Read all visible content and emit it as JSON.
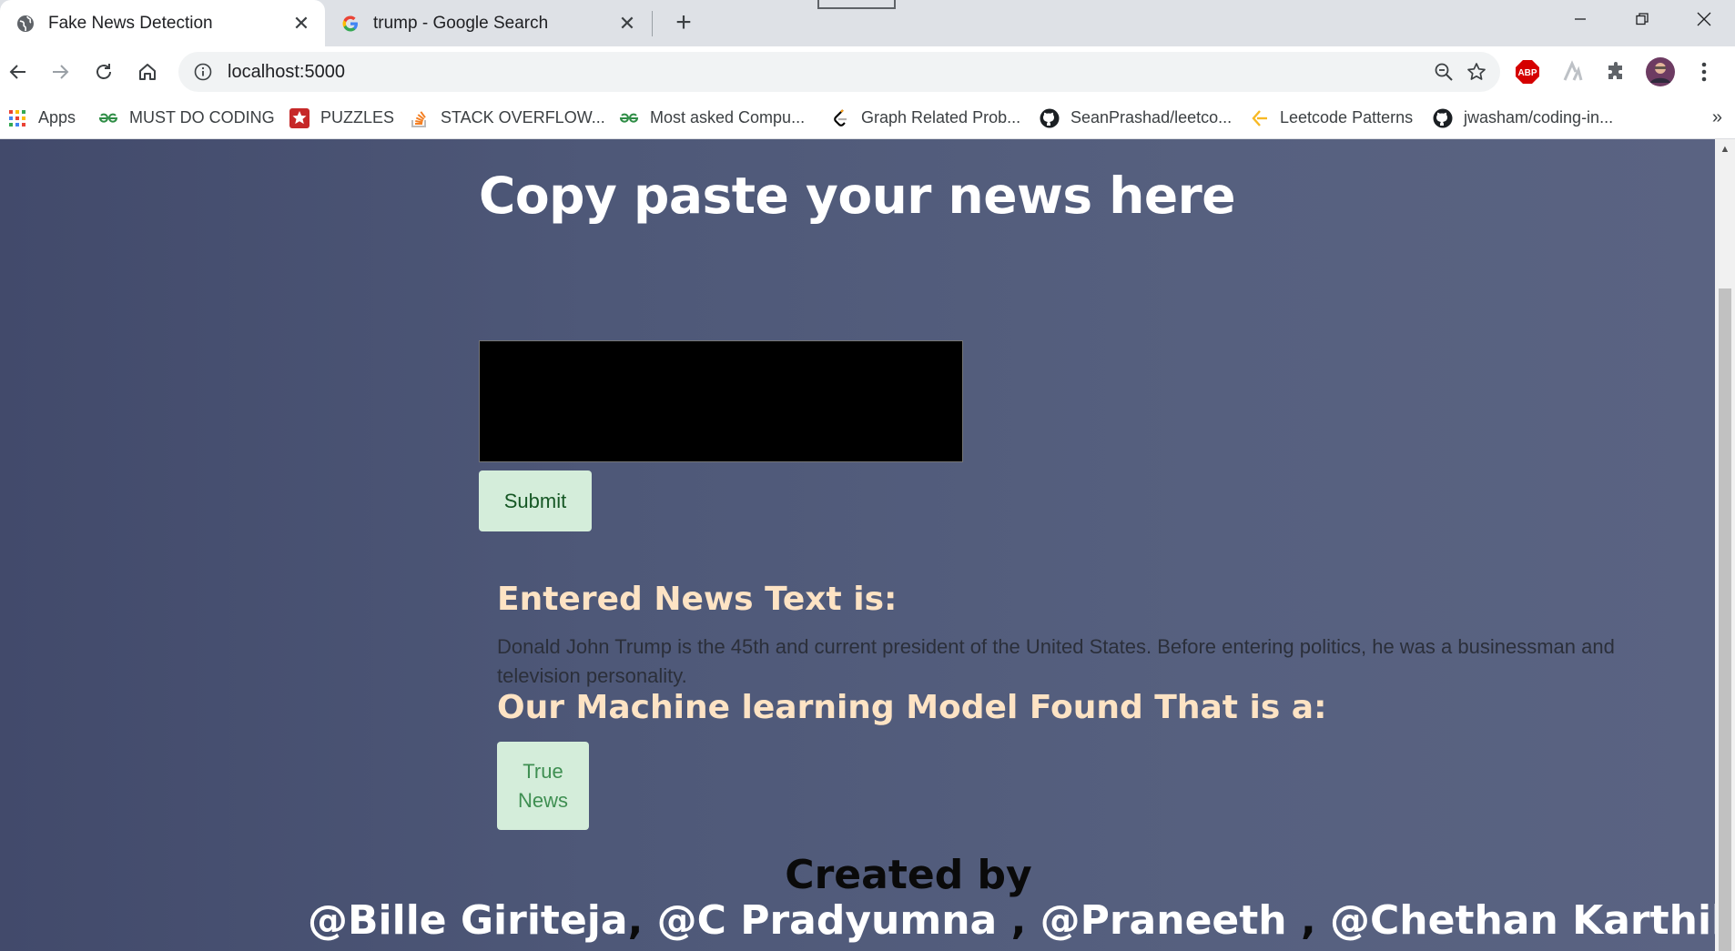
{
  "browser": {
    "tabs": [
      {
        "title": "Fake News Detection",
        "icon": "globe-icon",
        "active": true
      },
      {
        "title": "trump - Google Search",
        "icon": "google-icon",
        "active": false
      }
    ],
    "url": "localhost:5000",
    "bookmarks": [
      {
        "label": "Apps",
        "icon": "apps-grid-icon"
      },
      {
        "label": "MUST DO CODING",
        "icon": "gfg-icon"
      },
      {
        "label": "PUZZLES",
        "icon": "puzzle-star-icon"
      },
      {
        "label": "STACK OVERFLOW...",
        "icon": "stackoverflow-icon"
      },
      {
        "label": "Most asked Compu...",
        "icon": "gfg-icon"
      },
      {
        "label": "Graph Related Prob...",
        "icon": "leetcode-icon"
      },
      {
        "label": "SeanPrashad/leetco...",
        "icon": "github-icon"
      },
      {
        "label": "Leetcode Patterns",
        "icon": "leetcode-patterns-icon"
      },
      {
        "label": "jwasham/coding-in...",
        "icon": "github-icon"
      }
    ],
    "more_bookmarks": "»",
    "extensions": [
      "adblock-icon",
      "arrows-icon",
      "puzzle-extension-icon",
      "profile-avatar"
    ]
  },
  "page": {
    "heading": "Copy paste your news here",
    "input_value": "",
    "submit_label": "Submit",
    "entered_heading": "Entered News Text is:",
    "entered_text": "Donald John Trump is the 45th and current president of the United States. Before entering politics, he was a businessman and television personality.",
    "model_heading": "Our Machine learning Model Found That is a:",
    "result": "True News",
    "created_by": "Created by",
    "authors": [
      "@Bille Giriteja",
      "@C Pradyumna ",
      "@Praneeth ",
      "@Chethan Karthikeya"
    ],
    "author_separators": [
      ", ",
      ", ",
      ", ",
      "."
    ]
  },
  "colors": {
    "heading": "#ffffff",
    "subheading": "#fde3c4",
    "success_bg": "#d4edda",
    "page_bg_left": "#424a6b",
    "page_bg_right": "#5a6382"
  }
}
